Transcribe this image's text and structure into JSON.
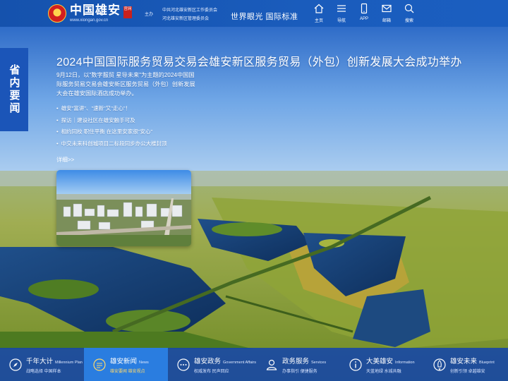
{
  "header": {
    "logo_title": "中国雄安",
    "logo_url": "www.xiongan.gov.cn",
    "logo_seal": "官网",
    "sponsor_label": "主办",
    "sponsors": [
      "中共河北雄安新区工作委员会",
      "河北雄安新区管理委员会"
    ],
    "slogan": "世界眼光 国际标准",
    "nav": [
      {
        "label": "主页",
        "icon": "home-icon"
      },
      {
        "label": "导航",
        "icon": "menu-icon"
      },
      {
        "label": "APP",
        "icon": "mobile-icon"
      },
      {
        "label": "邮箱",
        "icon": "mail-icon"
      },
      {
        "label": "搜索",
        "icon": "search-icon"
      }
    ]
  },
  "side_tab": {
    "label": "省内要闻"
  },
  "news": {
    "headline": "2024中国国际服务贸易交易会雄安新区服务贸易（外包）创新发展大会成功举办",
    "summary": "9月12日，以\"数字服贸 星导未来\"为主题的2024中国国际服务贸易交易会雄安新区服务贸易（外包）创新发展大会在雄安国际酒店成功举办。",
    "bullets": [
      "雄安\"富讲\"、\"速新\"又\"走心\"！",
      "探访｜建设社区在雄安触手可及",
      "相约同校 职住平衡 在这里安家很\"安心\"",
      "中交未来科创城项目二标段同步办公大楼封顶"
    ],
    "more": "详细>>"
  },
  "bottom_tiles": [
    {
      "title": "千年大计",
      "en": "Millennium Plan",
      "sub": "战略选择 中国样本",
      "icon": "compass-icon",
      "active": false
    },
    {
      "title": "雄安新闻",
      "en": "News",
      "sub": "雄安要闻  雄安视点",
      "icon": "news-icon",
      "active": true
    },
    {
      "title": "雄安政务",
      "en": "Government Affairs",
      "sub": "权威发布 民声回应",
      "icon": "chat-icon",
      "active": false
    },
    {
      "title": "政务服务",
      "en": "Services",
      "sub": "办事指引 便捷服务",
      "icon": "user-icon",
      "active": false
    },
    {
      "title": "大美雄安",
      "en": "Information",
      "sub": "天蓝地绿 水城共融",
      "icon": "info-icon",
      "active": false
    },
    {
      "title": "雄安未来",
      "en": "Blueprint",
      "sub": "创新引领 卓越雄安",
      "icon": "rocket-icon",
      "active": false
    }
  ],
  "colors": {
    "header_bg": "#1552ad",
    "tab_bg": "#1b55b8",
    "active_tile": "#2a7de0",
    "accent_text": "#ffd96a"
  }
}
